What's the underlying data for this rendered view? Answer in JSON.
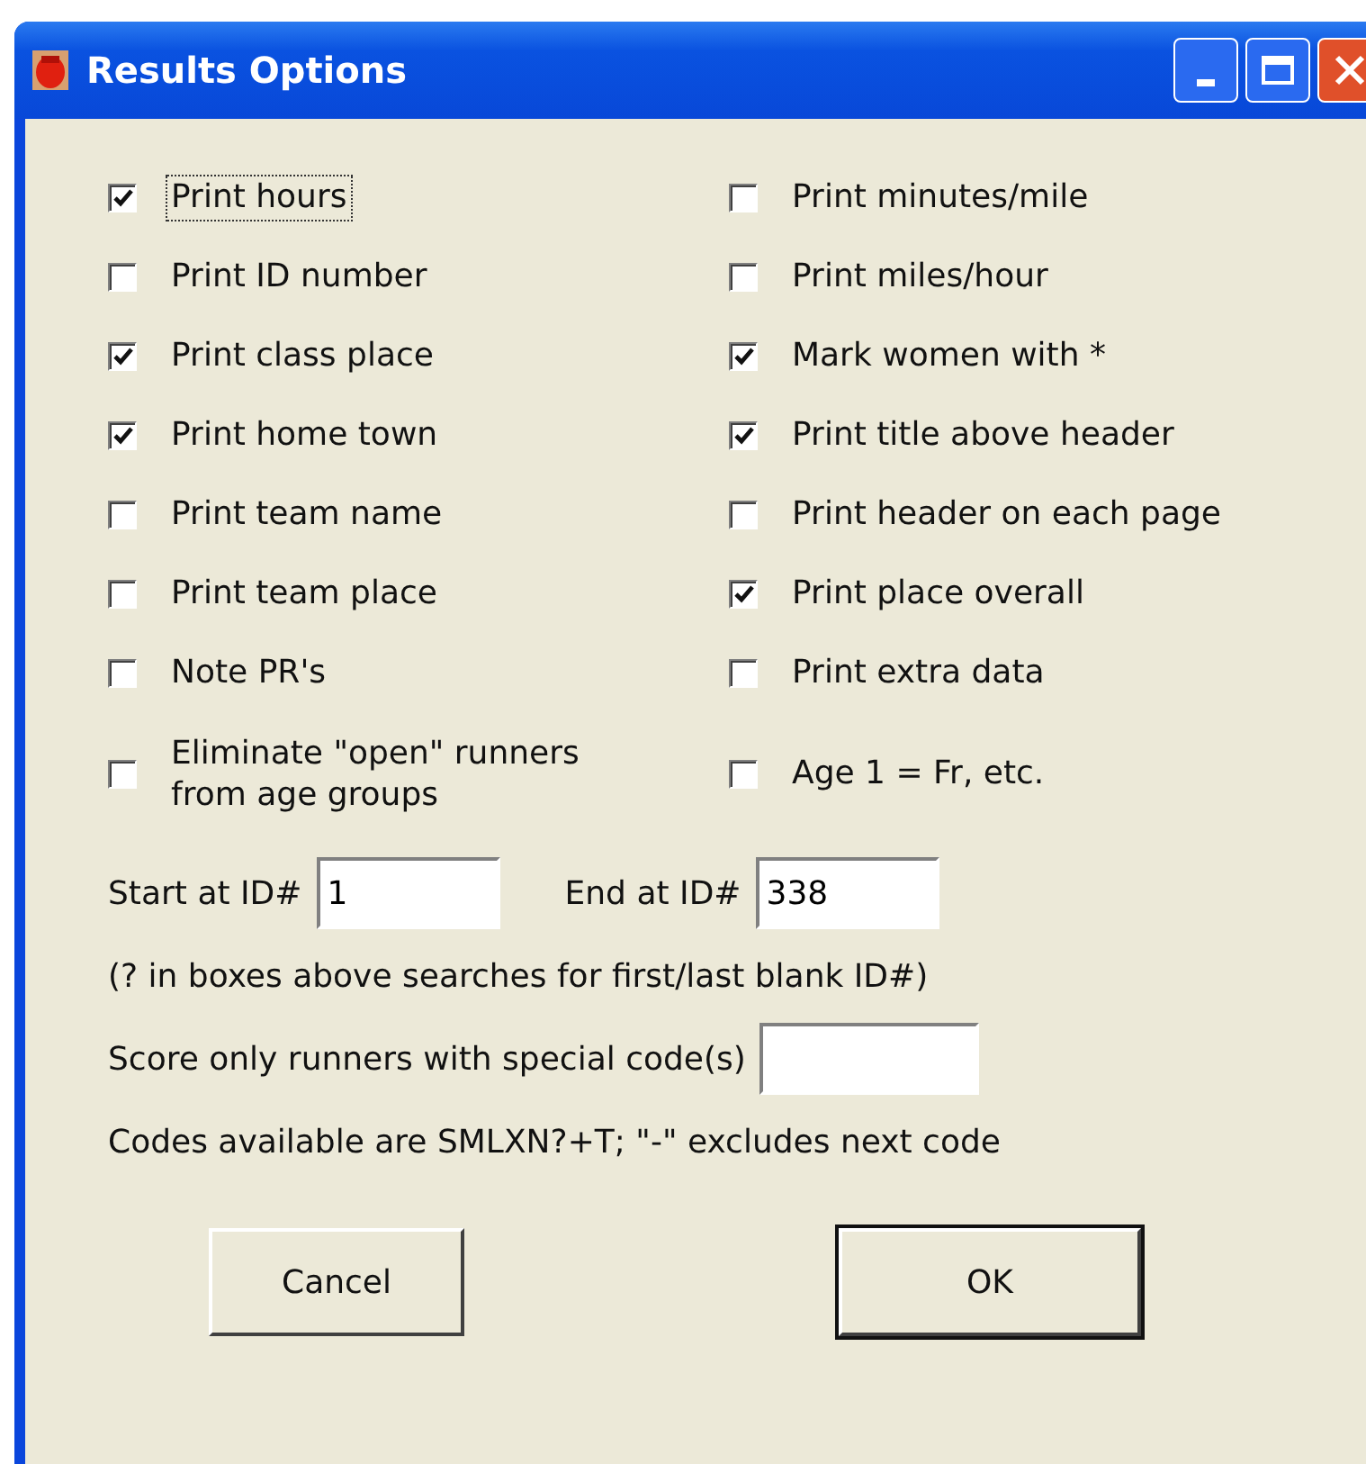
{
  "window": {
    "title": "Results Options"
  },
  "columns": [
    [
      {
        "label": "Print hours",
        "checked": true,
        "focused": true
      },
      {
        "label": "Print ID number",
        "checked": false,
        "focused": false
      },
      {
        "label": "Print class place",
        "checked": true,
        "focused": false
      },
      {
        "label": "Print home town",
        "checked": true,
        "focused": false
      },
      {
        "label": "Print team name",
        "checked": false,
        "focused": false
      },
      {
        "label": "Print team place",
        "checked": false,
        "focused": false
      },
      {
        "label": "Note PR's",
        "checked": false,
        "focused": false
      },
      {
        "label": "Eliminate \"open\" runners from age groups",
        "checked": false,
        "focused": false
      }
    ],
    [
      {
        "label": "Print minutes/mile",
        "checked": false,
        "focused": false
      },
      {
        "label": "Print miles/hour",
        "checked": false,
        "focused": false
      },
      {
        "label": "Mark women with *",
        "checked": true,
        "focused": false
      },
      {
        "label": "Print title above header",
        "checked": true,
        "focused": false
      },
      {
        "label": "Print header on each page",
        "checked": false,
        "focused": false
      },
      {
        "label": "Print place overall",
        "checked": true,
        "focused": false
      },
      {
        "label": "Print extra data",
        "checked": false,
        "focused": false
      },
      {
        "label": "Age 1 = Fr, etc.",
        "checked": false,
        "focused": false
      }
    ]
  ],
  "start": {
    "label": "Start at ID#",
    "value": "1"
  },
  "end": {
    "label": "End at ID#",
    "value": "338"
  },
  "hint": "(? in boxes above searches for first/last blank ID#)",
  "codes": {
    "label": "Score only runners with special code(s)"
  },
  "codes_note": "Codes available are SMLXN?+T; \"-\" excludes next code",
  "buttons": [
    {
      "label": "Cancel",
      "default": false
    },
    {
      "label": "OK",
      "default": true
    }
  ]
}
